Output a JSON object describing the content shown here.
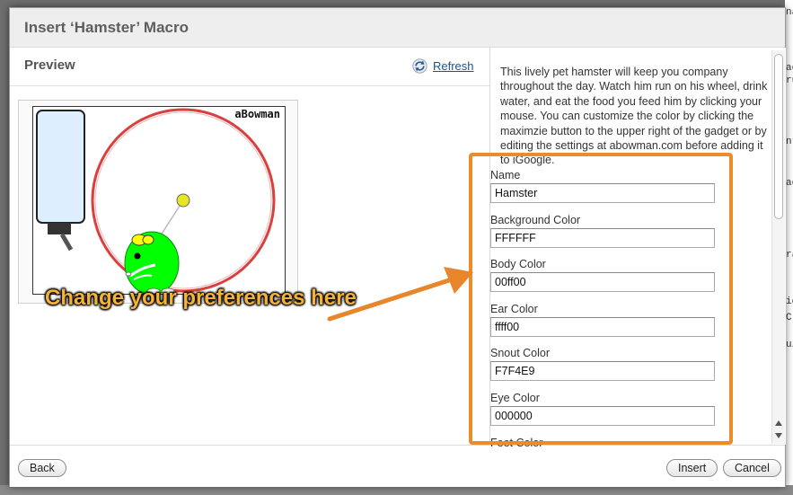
{
  "dialog": {
    "title": "Insert ‘Hamster’ Macro"
  },
  "preview": {
    "label": "Preview",
    "refresh_label": "Refresh",
    "gadget_brand": "aBowman"
  },
  "annotation": {
    "text": "Change your preferences here",
    "color": "#ec8c29"
  },
  "description": "This lively pet hamster will keep you company throughout the day. Watch him run on his wheel, drink water, and eat the food you feed him by clicking your mouse. You can customize the color by clicking the maximzie button to the upper right of the gadget or by editing the settings at abowman.com before adding it to iGoogle.",
  "fields": [
    {
      "label": "Name",
      "value": "Hamster"
    },
    {
      "label": "Background Color",
      "value": "FFFFFF"
    },
    {
      "label": "Body Color",
      "value": "00ff00"
    },
    {
      "label": "Ear Color",
      "value": "ffff00"
    },
    {
      "label": "Snout Color",
      "value": "F7F4E9"
    },
    {
      "label": "Eye Color",
      "value": "000000"
    },
    {
      "label": "Feet Color",
      "value": ""
    }
  ],
  "buttons": {
    "back": "Back",
    "insert": "Insert",
    "cancel": "Cancel"
  },
  "background_fragments": [
    "na",
    "ac",
    "ru",
    "nt",
    "ac",
    "ra",
    "ic",
    "C",
    "ui"
  ],
  "colors": {
    "hamster_body": "#00ff00",
    "hamster_ear": "#ffff00",
    "wheel": "#d94040",
    "water_bottle": "#ddeeff"
  }
}
